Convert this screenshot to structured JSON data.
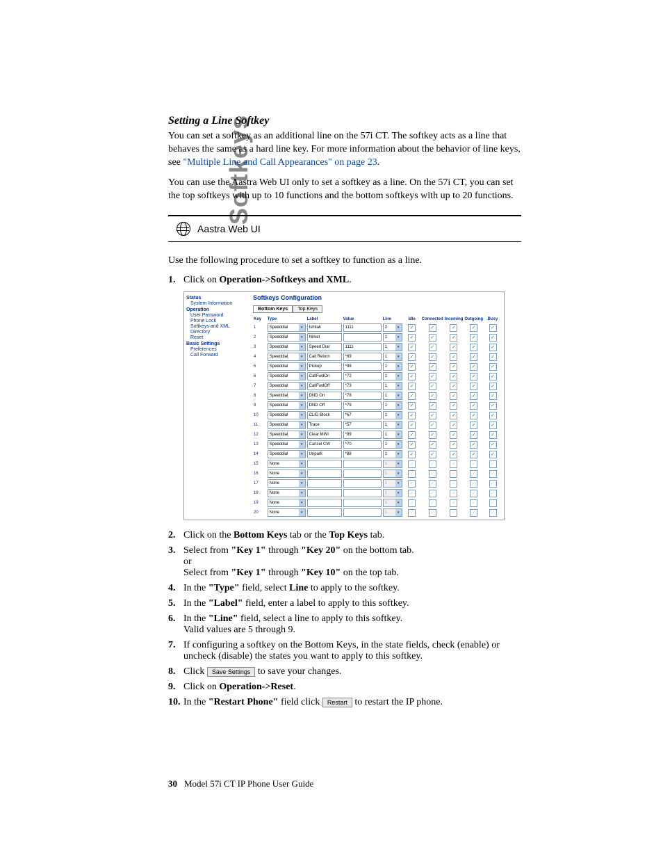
{
  "side_title": "Softkeys",
  "section_title": "Setting a Line Softkey",
  "para1a": "You can set a softkey as an additional line on the 57i CT. The softkey acts as a line that behaves the same as a hard line key. For more information about the behavior of line keys, see ",
  "para1_link": "\"Multiple Line and Call Appearances\"",
  "para1_on": " on ",
  "para1_page": "page 23",
  "para1_dot": ".",
  "para2": "You can use the Aastra Web UI only to set a softkey as a line. On the 57i CT, you can set the top softkeys with up to 10 functions and the bottom softkeys with up to 20 functions.",
  "aastra_label": "Aastra Web UI",
  "intro": "Use the following procedure to set a softkey to function as a line.",
  "steps": {
    "s1a": "Click on ",
    "s1b": "Operation->Softkeys and XML",
    "s1c": ".",
    "s2a": "Click on the ",
    "s2b": "Bottom Keys",
    "s2c": " tab or the ",
    "s2d": "Top Keys",
    "s2e": " tab.",
    "s3a": "Select from ",
    "s3b": "\"Key 1\"",
    "s3c": " through ",
    "s3d": "\"Key 20\"",
    "s3e": " on the bottom tab.",
    "s3or": "or",
    "s3f": "Select from ",
    "s3g": "\"Key 1\"",
    "s3h": " through ",
    "s3i": "\"Key 10\"",
    "s3j": " on the top tab.",
    "s4a": "In the ",
    "s4b": "\"Type\"",
    "s4c": " field, select ",
    "s4d": "Line",
    "s4e": " to apply to the softkey.",
    "s5a": "In the ",
    "s5b": "\"Label\"",
    "s5c": " field, enter a label to apply to this softkey.",
    "s6a": "In the ",
    "s6b": "\"Line\"",
    "s6c": " field, select a line to apply to this softkey.",
    "s6d": "Valid values are 5 through 9.",
    "s7": "If configuring a softkey on the Bottom Keys, in the state fields, check (enable) or uncheck (disable) the states you want to apply to this softkey.",
    "s8a": "Click ",
    "s8btn": "Save Settings",
    "s8b": " to save your changes.",
    "s9a": "Click on ",
    "s9b": "Operation->Reset",
    "s9c": ".",
    "s10a": "In the ",
    "s10b": "\"Restart Phone\"",
    "s10c": " field click ",
    "s10btn": "Restart",
    "s10d": " to restart the IP phone."
  },
  "ui": {
    "title": "Softkeys Configuration",
    "tabs": {
      "bottom": "Bottom Keys",
      "top": "Top Keys"
    },
    "nav": {
      "status": "Status",
      "sysinfo": "System Information",
      "operation": "Operation",
      "userpw": "User Password",
      "phonelock": "Phone Lock",
      "sxml": "Softkeys and XML",
      "dir": "Directory",
      "reset": "Reset",
      "basic": "Basic Settings",
      "prefs": "Preferences",
      "callfw": "Call Forward"
    },
    "headers": {
      "key": "Key",
      "type": "Type",
      "label": "Label",
      "value": "Value",
      "line": "Line",
      "idle": "Idle",
      "connected": "Connected",
      "incoming": "Incoming",
      "outgoing": "Outgoing",
      "busy": "Busy"
    },
    "rows": [
      {
        "key": "1",
        "type": "Speeddial",
        "label": "Ishtiak",
        "value": "1111",
        "line": "2",
        "on": true
      },
      {
        "key": "2",
        "type": "Speeddial",
        "label": "Nirket",
        "value": "",
        "line": "1",
        "on": true
      },
      {
        "key": "3",
        "type": "Speeddial",
        "label": "Speed Dial",
        "value": "1111",
        "line": "1",
        "on": true
      },
      {
        "key": "4",
        "type": "Speeddial",
        "label": "Call Return",
        "value": "*69",
        "line": "1",
        "on": true
      },
      {
        "key": "5",
        "type": "Speeddial",
        "label": "Pickup",
        "value": "*98",
        "line": "1",
        "on": true
      },
      {
        "key": "6",
        "type": "Speeddial",
        "label": "CallFwdOn",
        "value": "*72",
        "line": "1",
        "on": true
      },
      {
        "key": "7",
        "type": "Speeddial",
        "label": "CallFwdOff",
        "value": "*73",
        "line": "1",
        "on": true
      },
      {
        "key": "8",
        "type": "Speeddial",
        "label": "DND On",
        "value": "*78",
        "line": "1",
        "on": true
      },
      {
        "key": "9",
        "type": "Speeddial",
        "label": "DND Off",
        "value": "*79",
        "line": "1",
        "on": true
      },
      {
        "key": "10",
        "type": "Speeddial",
        "label": "CLID Block",
        "value": "*67",
        "line": "1",
        "on": true
      },
      {
        "key": "11",
        "type": "Speeddial",
        "label": "Trace",
        "value": "*57",
        "line": "1",
        "on": true
      },
      {
        "key": "12",
        "type": "Speeddial",
        "label": "Clear MWI",
        "value": "*99",
        "line": "1",
        "on": true
      },
      {
        "key": "13",
        "type": "Speeddial",
        "label": "Cancel CW",
        "value": "*70",
        "line": "1",
        "on": true
      },
      {
        "key": "14",
        "type": "Speeddial",
        "label": "Unpark",
        "value": "*88",
        "line": "1",
        "on": true
      },
      {
        "key": "15",
        "type": "None",
        "label": "",
        "value": "",
        "line": "1",
        "on": false
      },
      {
        "key": "16",
        "type": "None",
        "label": "",
        "value": "",
        "line": "1",
        "on": false
      },
      {
        "key": "17",
        "type": "None",
        "label": "",
        "value": "",
        "line": "1",
        "on": false
      },
      {
        "key": "18",
        "type": "None",
        "label": "",
        "value": "",
        "line": "1",
        "on": false
      },
      {
        "key": "19",
        "type": "None",
        "label": "",
        "value": "",
        "line": "1",
        "on": false
      },
      {
        "key": "20",
        "type": "None",
        "label": "",
        "value": "",
        "line": "1",
        "on": false
      }
    ]
  },
  "footer": {
    "page": "30",
    "text": "Model 57i CT IP Phone User Guide"
  }
}
